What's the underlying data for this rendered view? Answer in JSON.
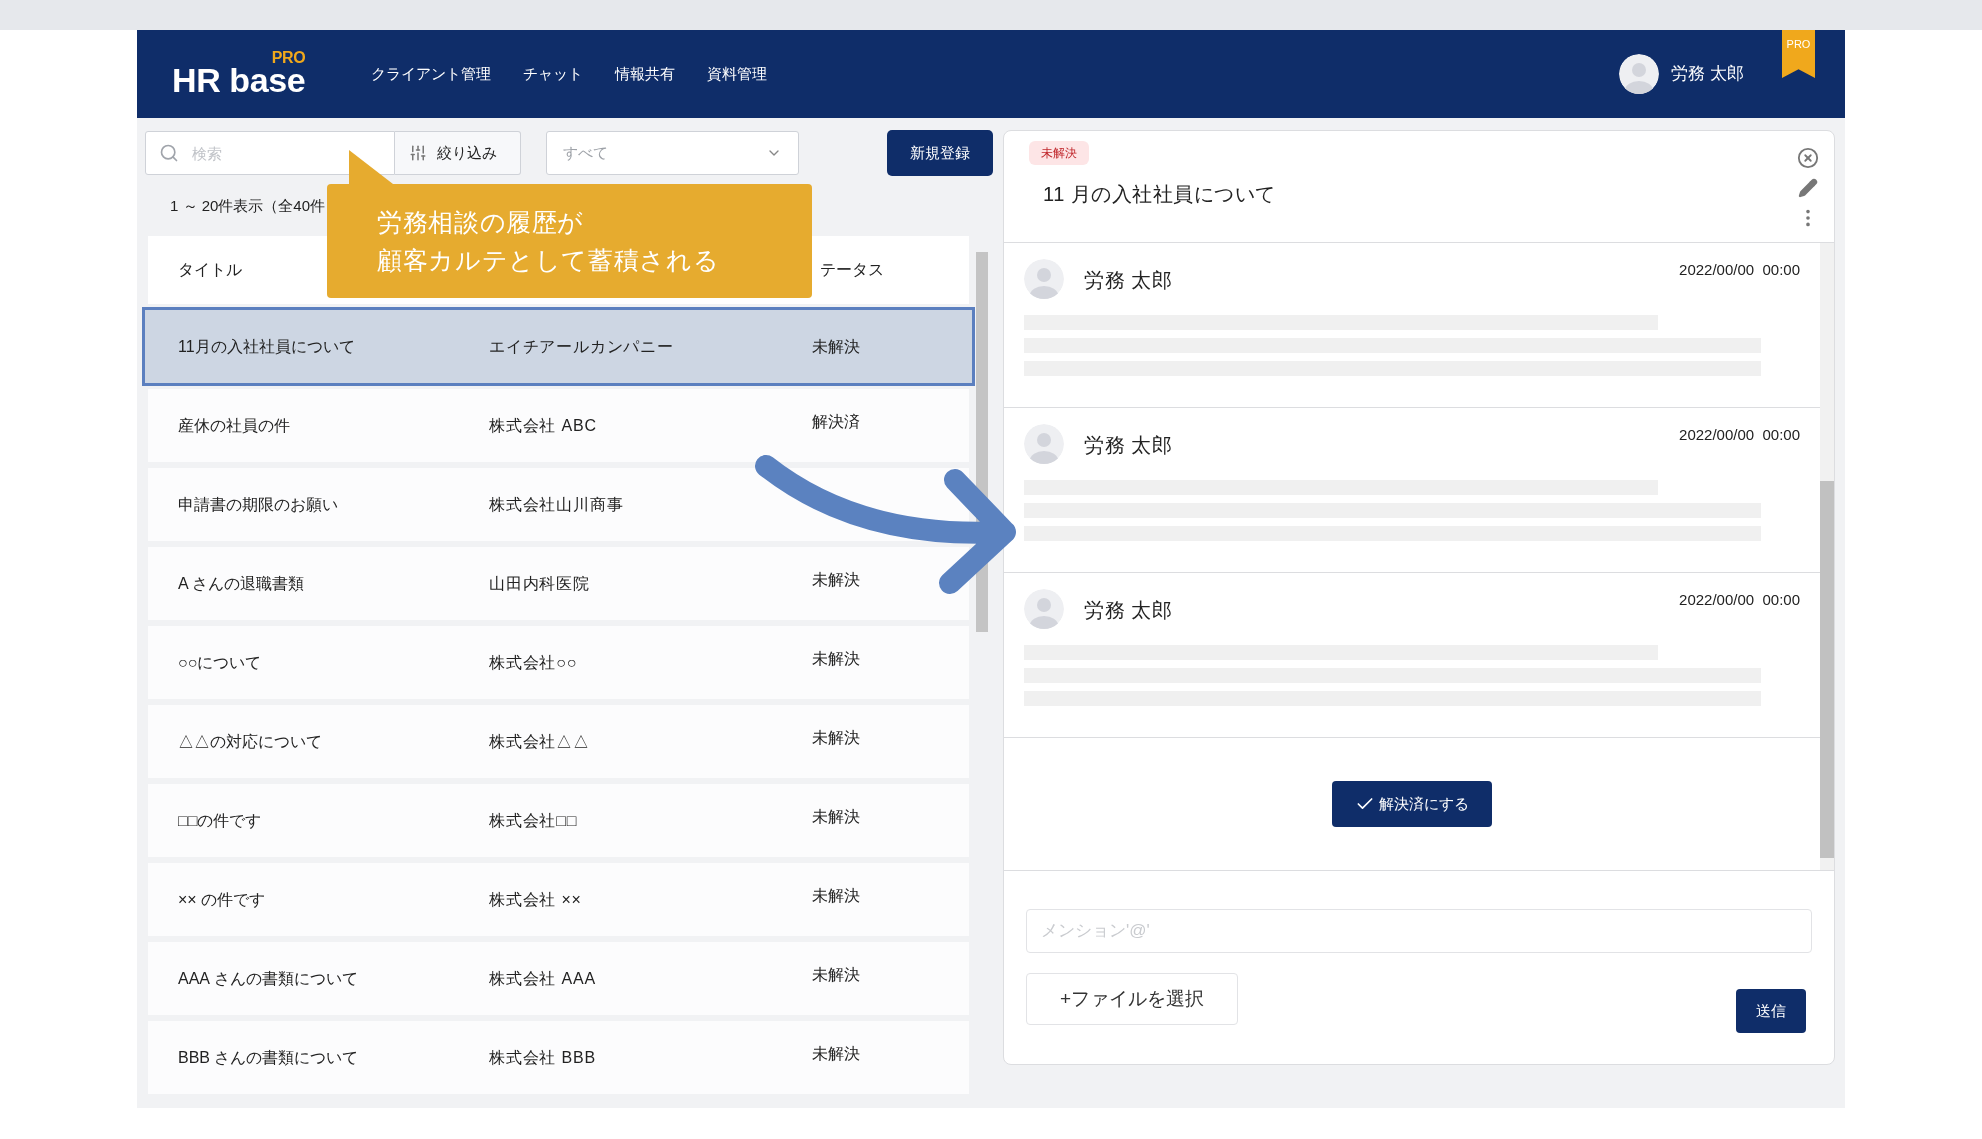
{
  "header": {
    "logo": "HR base",
    "logo_badge": "PRO",
    "nav": [
      "クライアント管理",
      "チャット",
      "情報共有",
      "資料管理"
    ],
    "user": "労務 太郎",
    "ribbon": "PRO"
  },
  "toolbar": {
    "search_placeholder": "検索",
    "filter": "絞り込み",
    "select": "すべて",
    "new_button": "新規登録"
  },
  "count": "1 ～ 20件表示（全40件",
  "callout": [
    "労務相談の履歴が",
    "顧客カルテとして蓄積される"
  ],
  "table": {
    "title_header": "タイトル",
    "status_header": "テータス",
    "rows": [
      {
        "title": "11月の入社社員について",
        "client": "エイチアールカンパニー",
        "status": "未解決",
        "selected": true
      },
      {
        "title": "産休の社員の件",
        "client": "株式会社 ABC",
        "status": "解決済",
        "selected": false
      },
      {
        "title": "申請書の期限のお願い",
        "client": "株式会社山川商事",
        "selected": false
      },
      {
        "title": "A さんの退職書類",
        "client": "山田内科医院",
        "status": "未解決",
        "selected": false
      },
      {
        "title": "○○について",
        "client": "株式会社○○",
        "status": "未解決",
        "selected": false
      },
      {
        "title": "△△の対応について",
        "client": "株式会社△△",
        "status": "未解決",
        "selected": false
      },
      {
        "title": "□□の件です",
        "client": "株式会社□□",
        "status": "未解決",
        "selected": false
      },
      {
        "title": "×× の件です",
        "client": "株式会社 ××",
        "status": "未解決",
        "selected": false
      },
      {
        "title": "AAA さんの書類について",
        "client": "株式会社 AAA",
        "status": "未解決",
        "selected": false
      },
      {
        "title": "BBB さんの書類について",
        "client": "株式会社 BBB",
        "status": "未解決",
        "selected": false
      }
    ]
  },
  "detail": {
    "badge": "未解決",
    "title": "11 月の入社社員について",
    "messages": [
      {
        "author": "労務 太郎",
        "time": "2022/00/00  00:00"
      },
      {
        "author": "労務 太郎",
        "time": "2022/00/00  00:00"
      },
      {
        "author": "労務 太郎",
        "time": "2022/00/00  00:00"
      }
    ],
    "resolve_button": "解決済にする",
    "mention_placeholder": "メンション'@'",
    "file_button": "+ファイルを選択",
    "send_button": "送信"
  }
}
